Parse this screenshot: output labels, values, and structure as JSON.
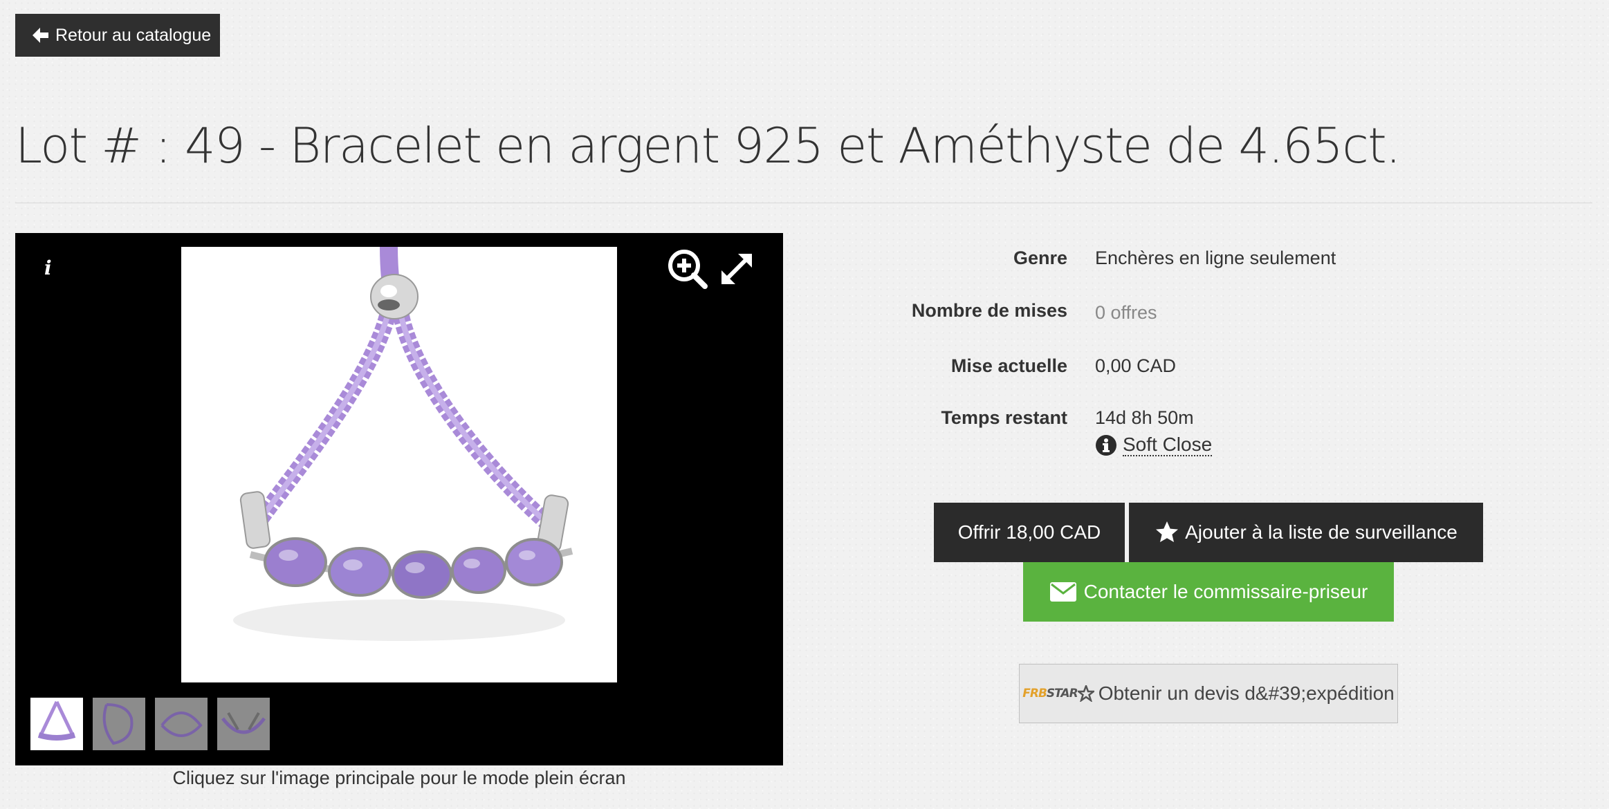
{
  "nav": {
    "back_label": "Retour au catalogue"
  },
  "lot": {
    "title": "Lot # : 49 - Bracelet en argent 925 et Améthyste de 4.65ct."
  },
  "gallery": {
    "caption": "Cliquez sur l'image principale pour le mode plein écran",
    "info_icon": "i",
    "thumbnail_count": 4
  },
  "details": {
    "genre_label": "Genre",
    "genre_value": "Enchères en ligne seulement",
    "bids_label": "Nombre de mises",
    "bids_value": "0 offres",
    "current_label": "Mise actuelle",
    "current_value": "0,00 CAD",
    "time_label": "Temps restant",
    "time_value": "14d 8h 50m",
    "soft_close_label": "Soft Close"
  },
  "actions": {
    "offer_label": "Offrir 18,00 CAD",
    "watchlist_label": "Ajouter à la liste de surveillance",
    "contact_label": "Contacter le commissaire-priseur",
    "shipping_label": "Obtenir un devis d&#39;expédition",
    "shipping_logo": "FRBSTAR"
  },
  "colors": {
    "dark_button": "#2b2b2b",
    "contact_green": "#5ab33f",
    "bracelet_cord": "#a98ad8",
    "amethyst": "#9b7fcf"
  }
}
